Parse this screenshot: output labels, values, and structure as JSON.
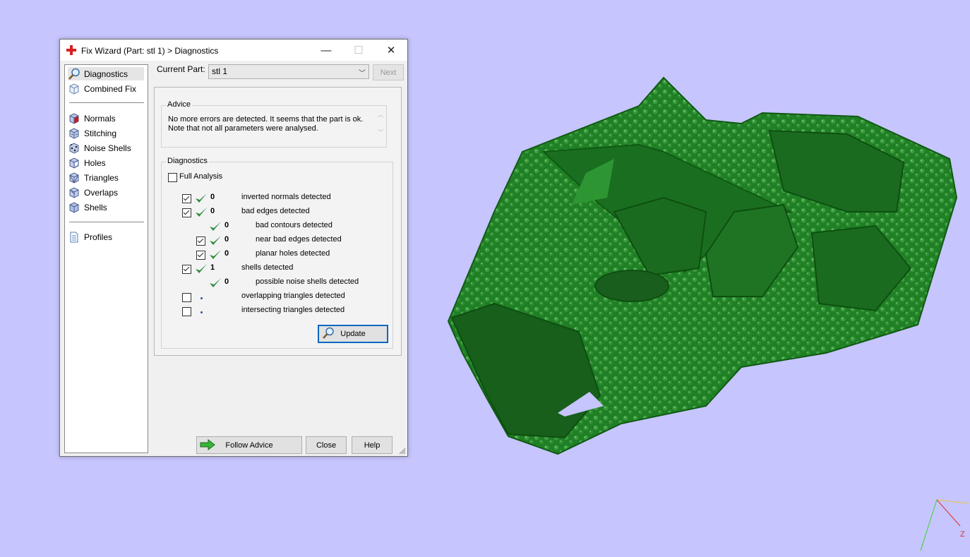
{
  "dialog": {
    "title": "Fix Wizard (Part: stl 1) > Diagnostics",
    "minimize_glyph": "—",
    "maximize_glyph": "☐",
    "close_glyph": "✕",
    "title_icon": "red-cross-icon"
  },
  "nav": {
    "items_top": [
      {
        "label": "Diagnostics",
        "icon": "magnifier-icon",
        "selected": true
      },
      {
        "label": "Combined Fix",
        "icon": "cube-icon"
      }
    ],
    "items_mid": [
      {
        "label": "Normals",
        "icon": "normals-cube-icon"
      },
      {
        "label": "Stitching",
        "icon": "stitching-cube-icon"
      },
      {
        "label": "Noise Shells",
        "icon": "noise-shells-icon"
      },
      {
        "label": "Holes",
        "icon": "holes-cube-icon"
      },
      {
        "label": "Triangles",
        "icon": "triangles-cube-icon"
      },
      {
        "label": "Overlaps",
        "icon": "overlaps-cube-icon"
      },
      {
        "label": "Shells",
        "icon": "shells-cube-icon"
      }
    ],
    "items_bottom": [
      {
        "label": "Profiles",
        "icon": "document-icon"
      }
    ]
  },
  "current_part": {
    "label": "Current Part:",
    "value": "stl 1",
    "arrow_glyph": "﹀"
  },
  "next_label": "Next",
  "advice": {
    "title": "Advice",
    "text": "No more errors are detected. It seems that the part is ok. Note that not all parameters were analysed.",
    "scroll_up_glyph": "︿",
    "scroll_down_glyph": "﹀"
  },
  "diagnostics": {
    "title": "Diagnostics",
    "full_analysis_label": "Full Analysis",
    "full_analysis_checked": false,
    "rows": [
      {
        "checkbox": true,
        "checked": true,
        "status": "ok",
        "count": "0",
        "label": "inverted normals detected",
        "indent": 0
      },
      {
        "checkbox": true,
        "checked": true,
        "status": "ok",
        "count": "0",
        "label": "bad edges detected",
        "indent": 0
      },
      {
        "checkbox": false,
        "checked": false,
        "status": "ok",
        "count": "0",
        "label": "bad contours detected",
        "indent": 1
      },
      {
        "checkbox": true,
        "checked": true,
        "status": "ok",
        "count": "0",
        "label": "near bad edges detected",
        "indent": 1
      },
      {
        "checkbox": true,
        "checked": true,
        "status": "ok",
        "count": "0",
        "label": "planar holes detected",
        "indent": 1
      },
      {
        "checkbox": true,
        "checked": true,
        "status": "ok",
        "count": "1",
        "label": "shells detected",
        "indent": 0
      },
      {
        "checkbox": false,
        "checked": false,
        "status": "ok",
        "count": "0",
        "label": "possible noise shells detected",
        "indent": 1
      },
      {
        "checkbox": true,
        "checked": false,
        "status": "pending",
        "count": "",
        "label": "overlapping triangles detected",
        "indent": 0
      },
      {
        "checkbox": true,
        "checked": false,
        "status": "pending",
        "count": "",
        "label": "intersecting triangles detected",
        "indent": 0
      }
    ],
    "update_label": "Update",
    "update_icon": "magnifier-icon"
  },
  "buttons": {
    "follow_advice_label": "Follow Advice",
    "follow_advice_icon": "green-arrow-right-icon",
    "close_label": "Close",
    "help_label": "Help"
  },
  "viewport": {
    "background": "#c6c5fd",
    "model_color": "#1e7a24",
    "axis_label_z": "Z"
  }
}
